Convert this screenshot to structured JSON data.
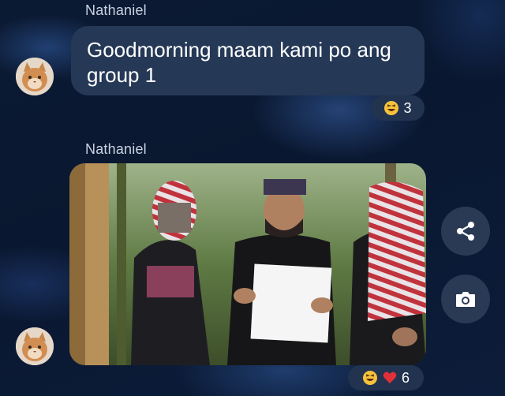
{
  "messages": [
    {
      "sender": "Nathaniel",
      "type": "text",
      "text": "Goodmorning maam kami po ang group 1",
      "reactions": {
        "emojis": [
          "laughing-emoji"
        ],
        "count": "3"
      }
    },
    {
      "sender": "Nathaniel",
      "type": "photo",
      "reactions": {
        "emojis": [
          "laughing-emoji",
          "heart-emoji"
        ],
        "count": "6"
      }
    }
  ],
  "actions": [
    {
      "icon": "share-icon"
    },
    {
      "icon": "camera-icon"
    }
  ],
  "colors": {
    "bubble": "#253856",
    "reaction_pill": "#22334f",
    "side_button": "#2a3a55",
    "sender_text": "#c9d3e3"
  }
}
